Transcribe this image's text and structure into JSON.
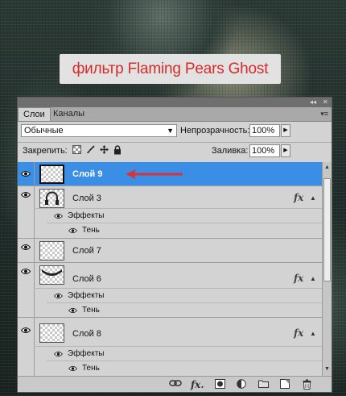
{
  "caption": "фильтр Flaming Pears Ghost",
  "panel": {
    "tabs": [
      {
        "label": "Слои",
        "active": true
      },
      {
        "label": "Каналы",
        "active": false
      }
    ],
    "blend_mode": "Обычные",
    "opacity_label": "Непрозрачность:",
    "opacity_value": "100%",
    "lock_label": "Закрепить:",
    "fill_label": "Заливка:",
    "fill_value": "100%"
  },
  "layers": [
    {
      "name": "Слой 9",
      "selected": true,
      "has_fx": false
    },
    {
      "name": "Слой 3",
      "selected": false,
      "has_fx": true,
      "fx": "fx",
      "effects_label": "Эффекты",
      "effect": "Тень"
    },
    {
      "name": "Слой 7",
      "selected": false,
      "has_fx": false
    },
    {
      "name": "Слой 6",
      "selected": false,
      "has_fx": true,
      "fx": "fx",
      "effects_label": "Эффекты",
      "effect": "Тень"
    },
    {
      "name": "Слой 8",
      "selected": false,
      "has_fx": true,
      "fx": "fx",
      "effects_label": "Эффекты",
      "effect": "Тень"
    }
  ],
  "colors": {
    "selection": "#3a8ee6",
    "arrow": "#d9333a",
    "caption_text": "#d52b2b"
  },
  "bottom_icons": [
    "link-icon",
    "fx-icon",
    "mask-icon",
    "adjustment-icon",
    "group-folder-icon",
    "new-layer-icon",
    "trash-icon"
  ]
}
